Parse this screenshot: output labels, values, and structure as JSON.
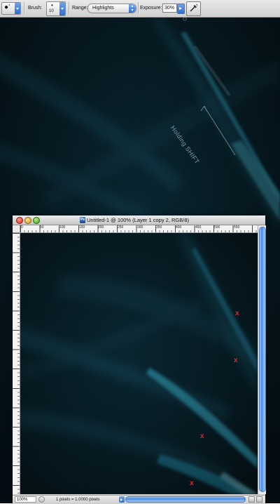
{
  "options_bar": {
    "tool_preset_icon": "dodge-tool-icon",
    "brush_label": "Brush:",
    "brush_size": "10",
    "range_label": "Range:",
    "range_value": "Highlights",
    "exposure_label": "Exposure:",
    "exposure_value": "30%",
    "airbrush_icon": "airbrush-icon"
  },
  "annotation": {
    "shift_text": "Holding SHIFT"
  },
  "document": {
    "title": "Untitled-1 @ 100% (Layer 1 copy 2, RGB/8)",
    "file_icon_letter": "Ps",
    "ruler_labels": [
      "0",
      "50",
      "100",
      "150",
      "200",
      "250",
      "300",
      "350",
      "400",
      "450",
      "500",
      "550"
    ],
    "zoom": "100%",
    "status_info": "1 pixels = 1.0000 pixels",
    "marks": [
      "x",
      "x",
      "x",
      "x"
    ]
  },
  "colors": {
    "canvas_bg": "#071a22",
    "highlight": "#35c6e8",
    "mark": "#e0262d"
  }
}
